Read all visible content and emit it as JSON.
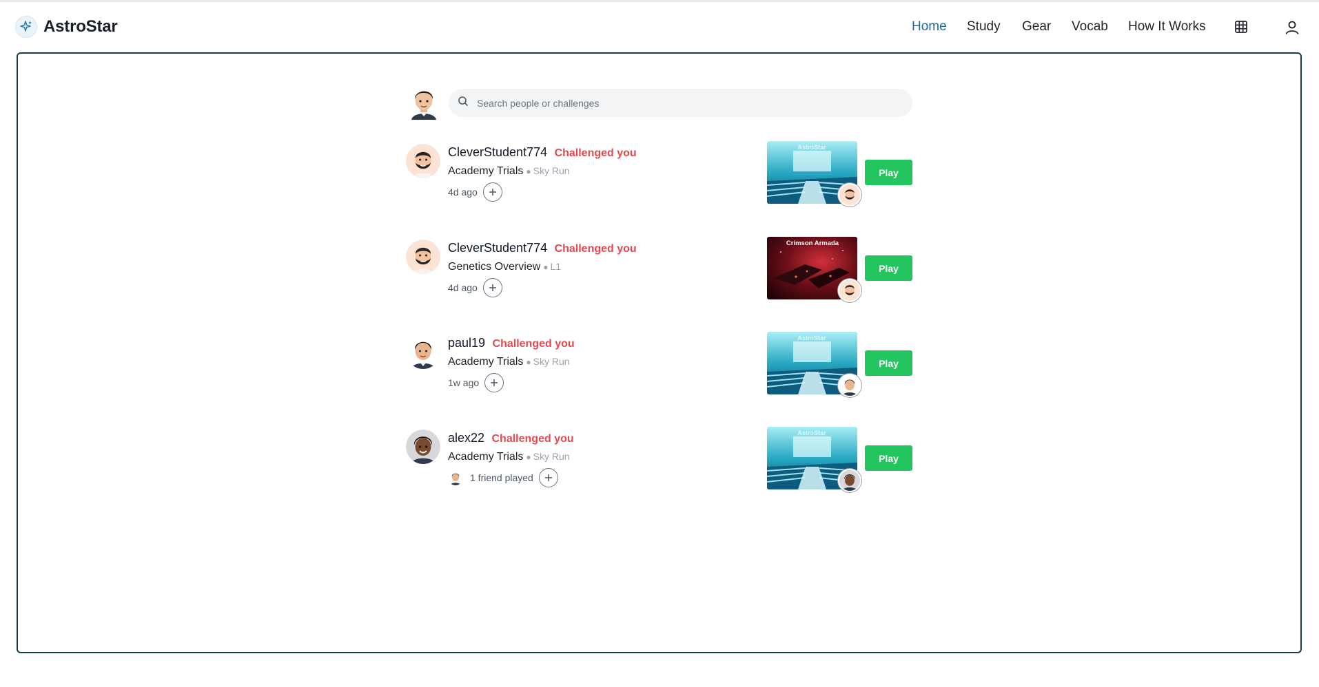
{
  "app": {
    "name": "AstroStar"
  },
  "nav": {
    "items": [
      {
        "label": "Home",
        "active": true
      },
      {
        "label": "Study"
      },
      {
        "label": "Gear"
      },
      {
        "label": "Vocab"
      },
      {
        "label": "How It Works"
      }
    ],
    "grid_icon": "grid-icon",
    "user_icon": "user-icon"
  },
  "search": {
    "placeholder": "Search people or challenges",
    "icon": "search-icon"
  },
  "colors": {
    "accent": "#1f6a9a",
    "challenge": "#e5484d",
    "play": "#22c55e",
    "panel_border": "#163c50"
  },
  "challenges": [
    {
      "user": "CleverStudent774",
      "status": "Challenged you",
      "game": "Academy Trials",
      "mode": "Sky Run",
      "time": "4d ago",
      "thumb": "academy",
      "thumb_title": "AstroStar",
      "play": "Play"
    },
    {
      "user": "CleverStudent774",
      "status": "Challenged you",
      "game": "Genetics Overview",
      "mode": "L1",
      "time": "4d ago",
      "thumb": "crimson",
      "thumb_title": "Crimson Armada",
      "play": "Play"
    },
    {
      "user": "paul19",
      "status": "Challenged you",
      "game": "Academy Trials",
      "mode": "Sky Run",
      "time": "1w ago",
      "thumb": "academy",
      "thumb_title": "AstroStar",
      "play": "Play"
    },
    {
      "user": "alex22",
      "status": "Challenged you",
      "game": "Academy Trials",
      "mode": "Sky Run",
      "time": "1 friend played",
      "thumb": "academy",
      "thumb_title": "AstroStar",
      "play": "Play"
    }
  ]
}
